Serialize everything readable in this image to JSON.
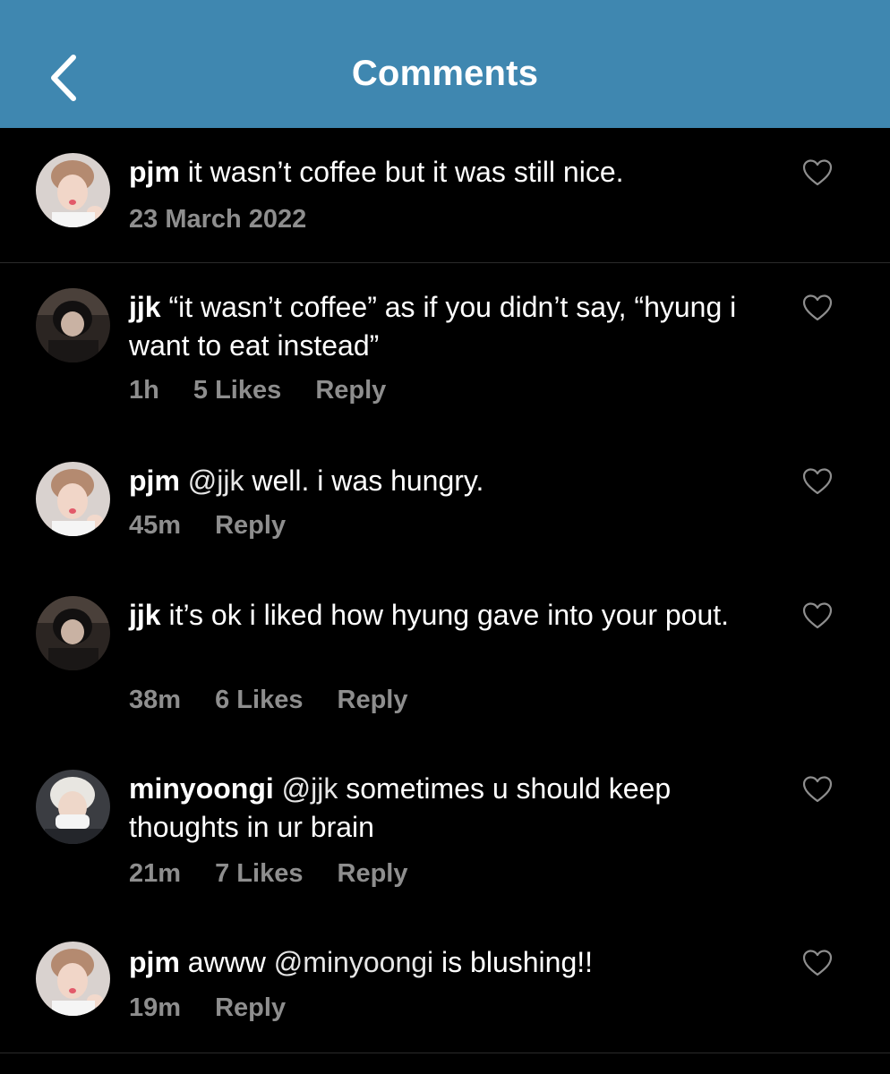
{
  "header": {
    "title": "Comments",
    "back_icon": "chevron-left-icon",
    "background": "#3f87b0"
  },
  "caption": {
    "username": "pjm",
    "text": " it wasn’t coffee but it was still nice.",
    "date": "23 March 2022"
  },
  "comments": [
    {
      "username": "jjk",
      "text": " “it wasn’t coffee” as if you didn’t say, “hyung i want to eat instead”",
      "time": "1h",
      "likes": "5 Likes",
      "reply": "Reply"
    },
    {
      "username": "pjm",
      "mention": " @jjk",
      "text": " well. i was hungry.",
      "time": "45m",
      "reply": "Reply"
    },
    {
      "username": "jjk",
      "text": " it’s ok i liked how hyung gave into your pout.",
      "time": "38m",
      "likes": "6 Likes",
      "reply": "Reply"
    },
    {
      "username": "minyoongi",
      "mention": " @jjk",
      "text": " sometimes u should keep thoughts in ur brain",
      "time": "21m",
      "likes": "7 Likes",
      "reply": "Reply"
    },
    {
      "username": "pjm",
      "text_before": " awww ",
      "mention": "@minyoongi",
      "text": " is blushing!!",
      "time": "19m",
      "reply": "Reply"
    }
  ],
  "icons": {
    "like": "heart-outline-icon"
  },
  "colors": {
    "meta_text": "#8e8e8e",
    "background": "#000000"
  }
}
